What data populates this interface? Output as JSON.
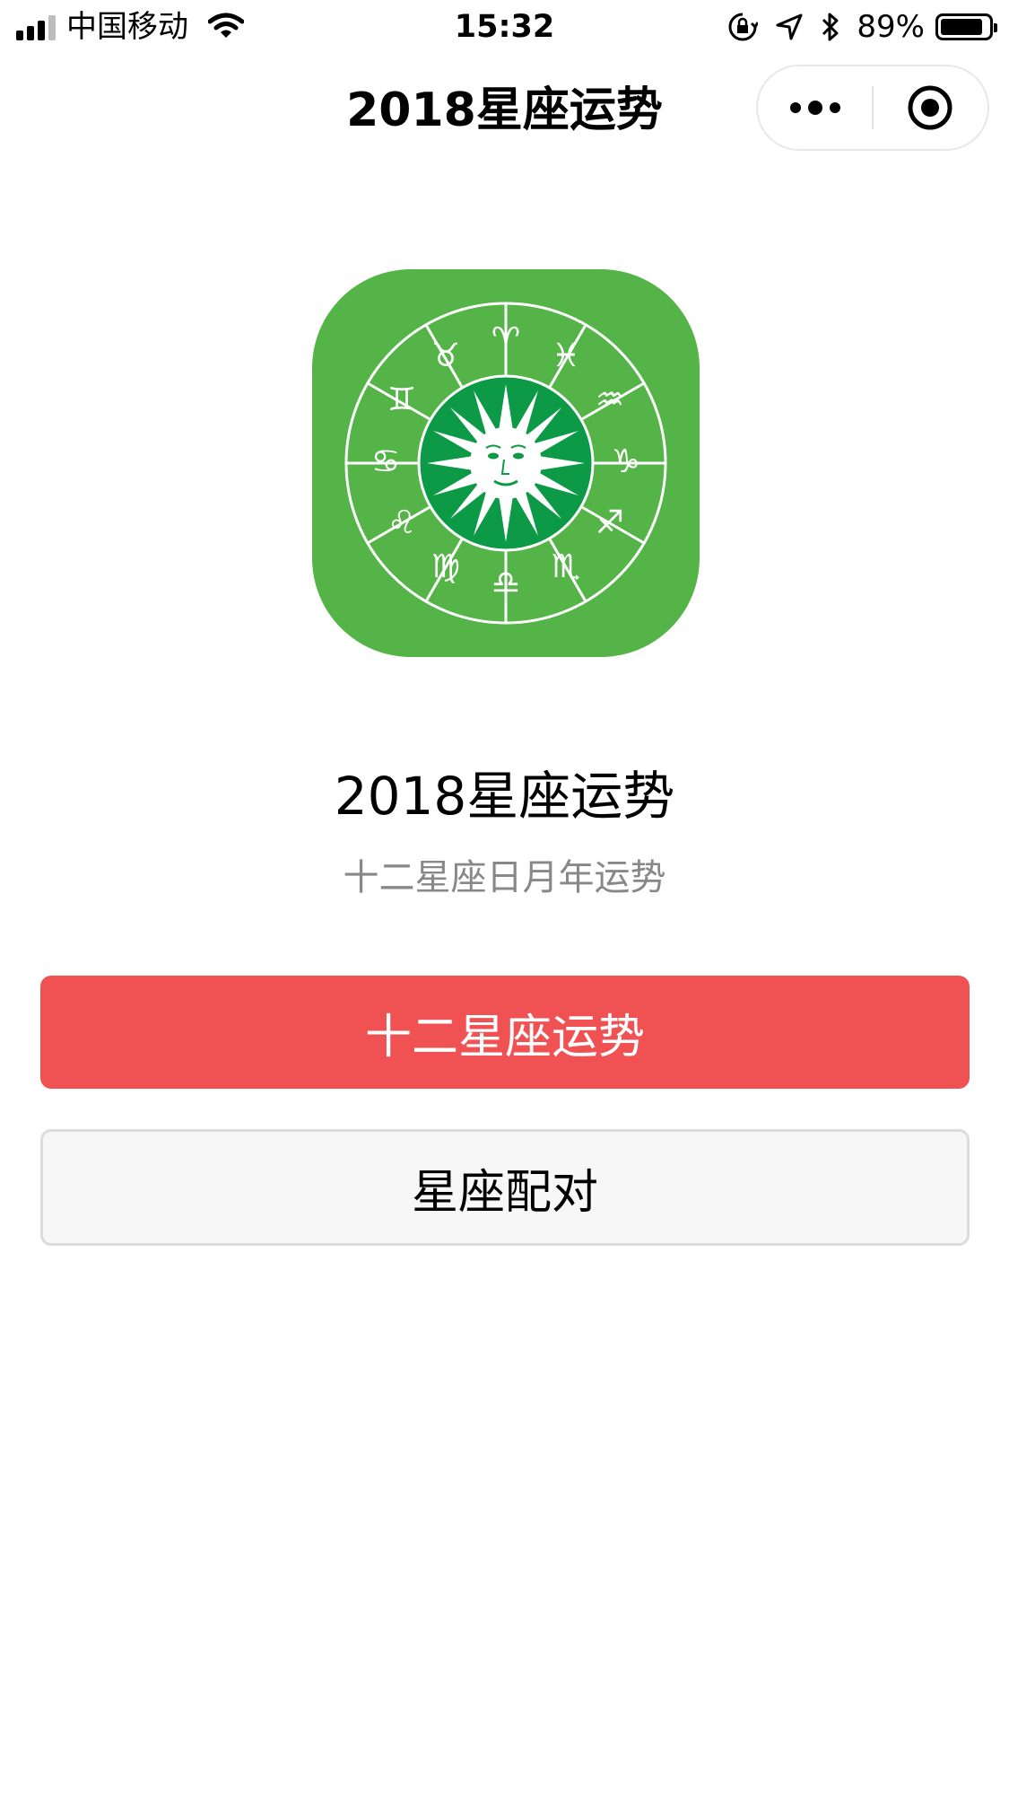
{
  "status_bar": {
    "carrier": "中国移动",
    "time": "15:32",
    "battery_percent": "89%",
    "battery_level": 0.89,
    "icons": [
      "signal-icon",
      "wifi-icon",
      "rotation-lock-icon",
      "location-icon",
      "bluetooth-icon",
      "battery-icon"
    ]
  },
  "nav": {
    "title": "2018星座运势",
    "capsule": {
      "more_icon": "more-dots-icon",
      "close_icon": "target-circle-icon"
    }
  },
  "app": {
    "logo_icon": "zodiac-wheel-sun-icon",
    "name": "2018星座运势",
    "description": "十二星座日月年运势"
  },
  "buttons": {
    "primary_label": "十二星座运势",
    "secondary_label": "星座配对"
  },
  "colors": {
    "primary_button": "#f05152",
    "secondary_button": "#f7f7f7",
    "logo_background": "#55b447",
    "logo_center": "#0d9a46",
    "description_text": "#888888"
  }
}
